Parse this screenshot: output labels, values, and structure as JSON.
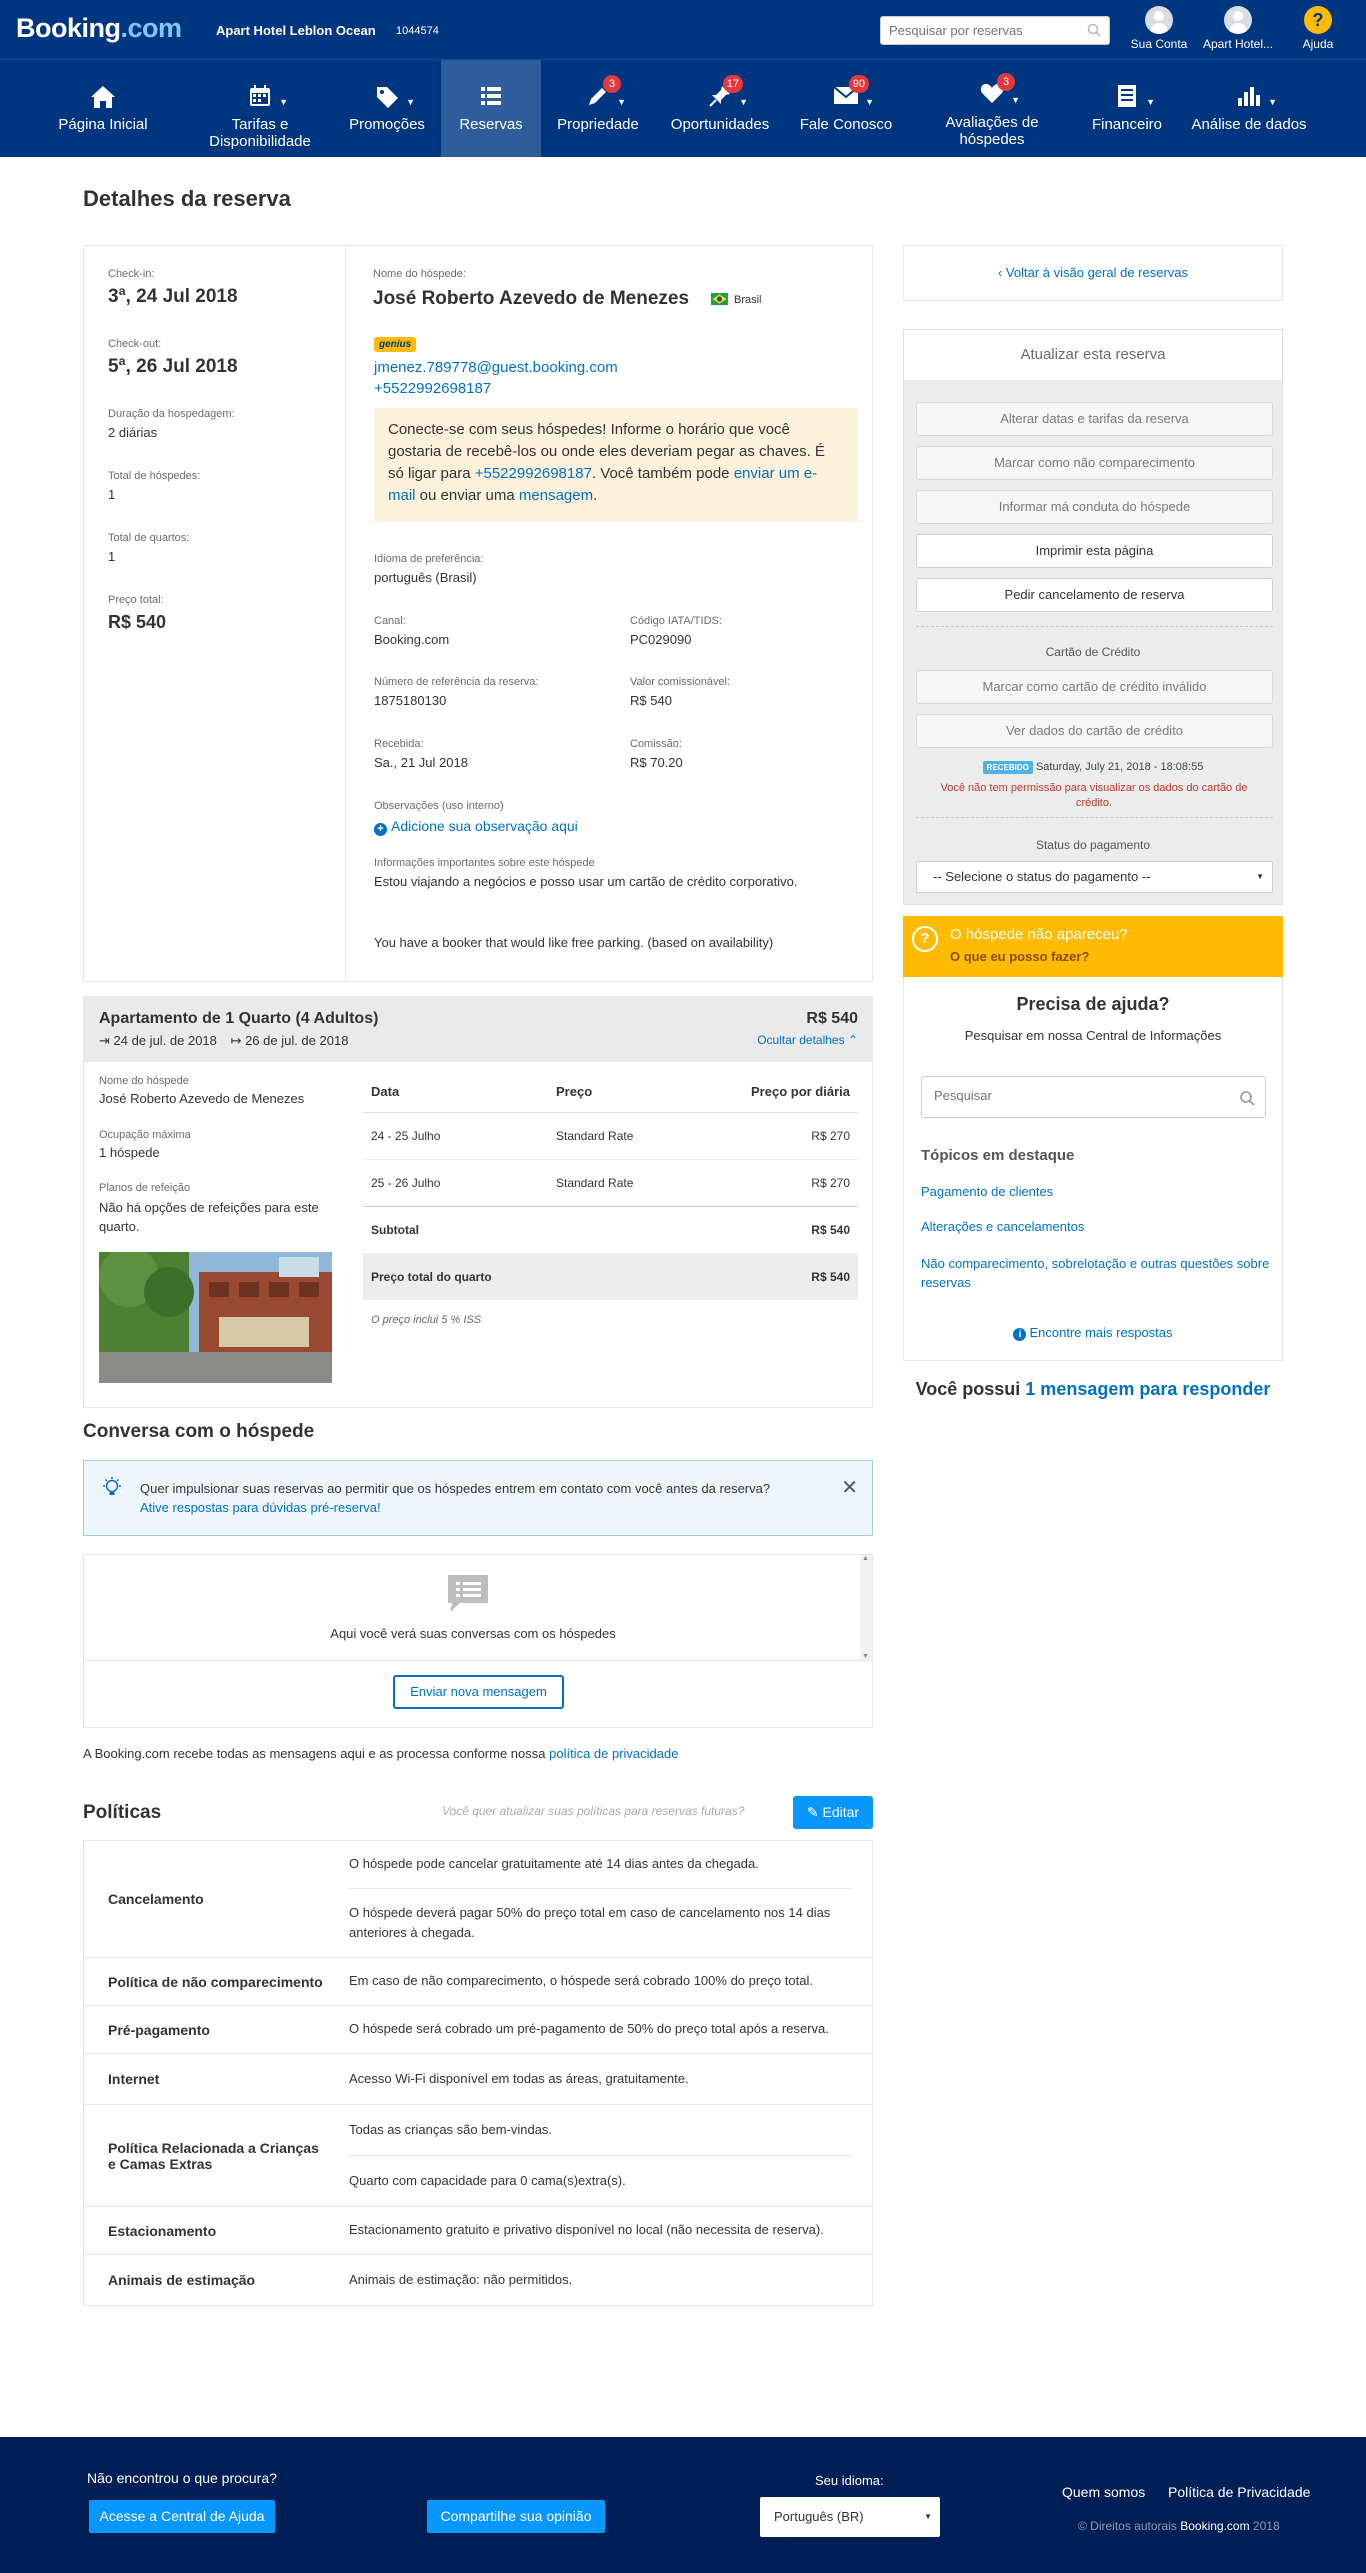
{
  "topbar": {
    "logo_main": "Booking",
    "logo_suffix": ".com",
    "hotel_name": "Apart Hotel Leblon Ocean",
    "hotel_id": "1044574",
    "search_placeholder": "Pesquisar por reservas",
    "account_label": "Sua Conta",
    "hotel_menu_label": "Apart Hotel...",
    "help_label": "Ajuda"
  },
  "nav": {
    "items": [
      {
        "label": "Página Inicial",
        "icon": "home-icon",
        "badge": ""
      },
      {
        "label": "Tarifas e Disponibilidade",
        "icon": "calendar-icon",
        "badge": ""
      },
      {
        "label": "Promoções",
        "icon": "tag-icon",
        "badge": ""
      },
      {
        "label": "Reservas",
        "icon": "list-icon",
        "badge": ""
      },
      {
        "label": "Propriedade",
        "icon": "pencil-icon",
        "badge": "3"
      },
      {
        "label": "Oportunidades",
        "icon": "pin-icon",
        "badge": "17"
      },
      {
        "label": "Fale Conosco",
        "icon": "envelope-icon",
        "badge": "90"
      },
      {
        "label": "Avaliações de hóspedes",
        "icon": "heart-icon",
        "badge": "3"
      },
      {
        "label": "Financeiro",
        "icon": "document-icon",
        "badge": ""
      },
      {
        "label": "Análise de dados",
        "icon": "bar-chart-icon",
        "badge": ""
      }
    ],
    "active": "Reservas"
  },
  "page_title": "Detalhes da reserva",
  "reservation": {
    "checkin_label": "Check-in:",
    "checkin_value": "3ª, 24 Jul 2018",
    "checkout_label": "Check-out:",
    "checkout_value": "5ª, 26 Jul 2018",
    "duration_label": "Duração da hospedagem:",
    "duration_value": "2 diárias",
    "guests_label": "Total de hóspedes:",
    "guests_value": "1",
    "rooms_label": "Total de quartos:",
    "rooms_value": "1",
    "price_label": "Preço total:",
    "price_value": "R$ 540",
    "guest_name_label": "Nome do hóspede:",
    "guest_name": "José Roberto Azevedo de Menezes",
    "guest_country": "Brasil",
    "genius_badge": "genius",
    "guest_email": "jmenez.789778@guest.booking.com",
    "guest_phone": "+5522992698187",
    "connect_text_1": "Conecte-se com seus hóspedes! Informe o horário que você gostaria de recebê-los ou onde eles deveriam pegar as chaves. É só ligar para ",
    "connect_phone": "+5522992698187",
    "connect_text_2": ". Você também pode ",
    "connect_link_email": "enviar um e-mail",
    "connect_text_3": " ou enviar uma ",
    "connect_link_message": "mensagem",
    "connect_text_4": ".",
    "language_label": "Idioma de preferência:",
    "language_value": "português (Brasil)",
    "channel_label": "Canal:",
    "channel_value": "Booking.com",
    "iata_label": "Código IATA/TIDS:",
    "iata_value": "PC029090",
    "ref_label": "Número de referência da reserva:",
    "ref_value": "1875180130",
    "commissionable_label": "Valor comissionável:",
    "commissionable_value": "R$ 540",
    "received_label": "Recebida:",
    "received_value": "Sa., 21 Jul 2018",
    "commission_label": "Comissão:",
    "commission_value": "R$ 70.20",
    "notes_label": "Observações (uso interno)",
    "notes_add": "Adicione sua observação aqui",
    "info_label": "Informações importantes sobre este hóspede",
    "info_value": "Estou viajando a negócios e posso usar um cartão de crédito corporativo.",
    "booker_note": "You have a booker that would like free parking. (based on availability)"
  },
  "sidebar": {
    "back_link": "Voltar à visão geral de reservas",
    "update_title": "Atualizar esta reserva",
    "btn_change_dates": "Alterar datas e tarifas da reserva",
    "btn_no_show": "Marcar como não comparecimento",
    "btn_misconduct": "Informar má conduta do hóspede",
    "btn_print": "Imprimir esta página",
    "btn_cancel": "Pedir cancelamento de reserva",
    "card_title": "Cartão de Crédito",
    "btn_invalid_card": "Marcar como cartão de crédito inválido",
    "btn_view_card": "Ver dados do cartão de crédito",
    "received_badge": "RECEBIDO",
    "received_time": "Saturday, July 21, 2018 - 18:08:55",
    "no_permission": "Você não tem permissão para visualizar os dados do cartão de crédito.",
    "payment_status_title": "Status do pagamento",
    "payment_status_select": "-- Selecione o status do pagamento --",
    "noshow_title": "O hóspede não apareceu?",
    "noshow_link": "O que eu posso fazer?",
    "help_title": "Precisa de ajuda?",
    "help_subtitle": "Pesquisar em nossa Central de Informações",
    "help_search_placeholder": "Pesquisar",
    "topics_title": "Tópicos em destaque",
    "topics": [
      "Pagamento de clientes",
      "Alterações e cancelamentos",
      "Não comparecimento, sobrelotação e outras questões sobre reservas"
    ],
    "more_answers": "Encontre mais respostas",
    "messages_prefix": "Você possui ",
    "messages_link": "1 mensagem para responder"
  },
  "room": {
    "title": "Apartamento de 1 Quarto (4 Adultos)",
    "price": "R$ 540",
    "checkin_date": "24 de jul. de 2018",
    "checkout_date": "26 de jul. de 2018",
    "hide_details": "Ocultar detalhes",
    "guest_name_label": "Nome do hóspede",
    "guest_name": "José Roberto Azevedo de Menezes",
    "occupancy_label": "Ocupação máxima",
    "occupancy_value": "1 hóspede",
    "meal_label": "Planos de refeição",
    "meal_value": "Não há opções de refeições para este quarto.",
    "columns": [
      "Data",
      "Preço",
      "Preço por diária"
    ],
    "rows": [
      {
        "date": "24 - 25 Julho",
        "rate": "Standard Rate",
        "price": "R$ 270"
      },
      {
        "date": "25 - 26 Julho",
        "rate": "Standard Rate",
        "price": "R$ 270"
      }
    ],
    "subtotal_label": "Subtotal",
    "subtotal_value": "R$ 540",
    "total_label": "Preço total do quarto",
    "total_value": "R$ 540",
    "tax_note": "O preço inclui 5 % ISS"
  },
  "conversation": {
    "title": "Conversa com o hóspede",
    "banner_text": "Quer impulsionar suas reservas ao permitir que os hóspedes entrem em contato com você antes da reserva?",
    "banner_link": "Ative respostas para dúvidas pré-reserva!",
    "empty_text": "Aqui você verá suas conversas com os hóspedes",
    "new_message_btn": "Enviar nova mensagem",
    "privacy_text": "A Booking.com recebe todas as mensagens aqui e as processa conforme nossa ",
    "privacy_link": "política de privacidade"
  },
  "policies": {
    "title": "Políticas",
    "update_hint": "Você quer atualizar suas políticas para reservas futuras?",
    "edit_btn": "Editar",
    "rows": [
      {
        "name": "Cancelamento",
        "values": [
          "O hóspede pode cancelar gratuitamente até 14 dias antes da chegada.",
          "O hóspede deverá pagar 50% do preço total em caso de cancelamento nos 14 dias anteriores à chegada."
        ]
      },
      {
        "name": "Política de não comparecimento",
        "values": [
          "Em caso de não comparecimento, o hóspede será cobrado 100% do preço total."
        ]
      },
      {
        "name": "Pré-pagamento",
        "values": [
          "O hóspede será cobrado um pré-pagamento de 50% do preço total após a reserva."
        ]
      },
      {
        "name": "Internet",
        "values": [
          "Acesso Wi-Fi disponível em todas as áreas, gratuitamente."
        ]
      },
      {
        "name": "Política Relacionada a Crianças e Camas Extras",
        "values": [
          "Todas as crianças são bem-vindas.",
          "Quarto com capacidade para 0 cama(s)extra(s)."
        ]
      },
      {
        "name": "Estacionamento",
        "values": [
          "Estacionamento gratuito e privativo disponível no local (não necessita de reserva)."
        ]
      },
      {
        "name": "Animais de estimação",
        "values": [
          "Animais de estimação: não permitidos."
        ]
      }
    ]
  },
  "footer": {
    "not_found": "Não encontrou o que procura?",
    "help_center_btn": "Acesse a Central de Ajuda",
    "feedback_btn": "Compartilhe sua opinião",
    "language_label": "Seu idioma:",
    "language_value": "Português (BR)",
    "about_link": "Quem somos",
    "privacy_link": "Política de Privacidade",
    "copyright_prefix": "© Direitos autorais ",
    "copyright_brand": "Booking.com",
    "copyright_year": " 2018"
  },
  "colors": {
    "brand_blue": "#003580",
    "nav_active": "#2f5d9b",
    "link_blue": "#0071c2",
    "badge_red": "#e0393e",
    "warning_yellow": "#febb02",
    "footer_bg": "#001f56",
    "button_blue": "#0896ff"
  }
}
